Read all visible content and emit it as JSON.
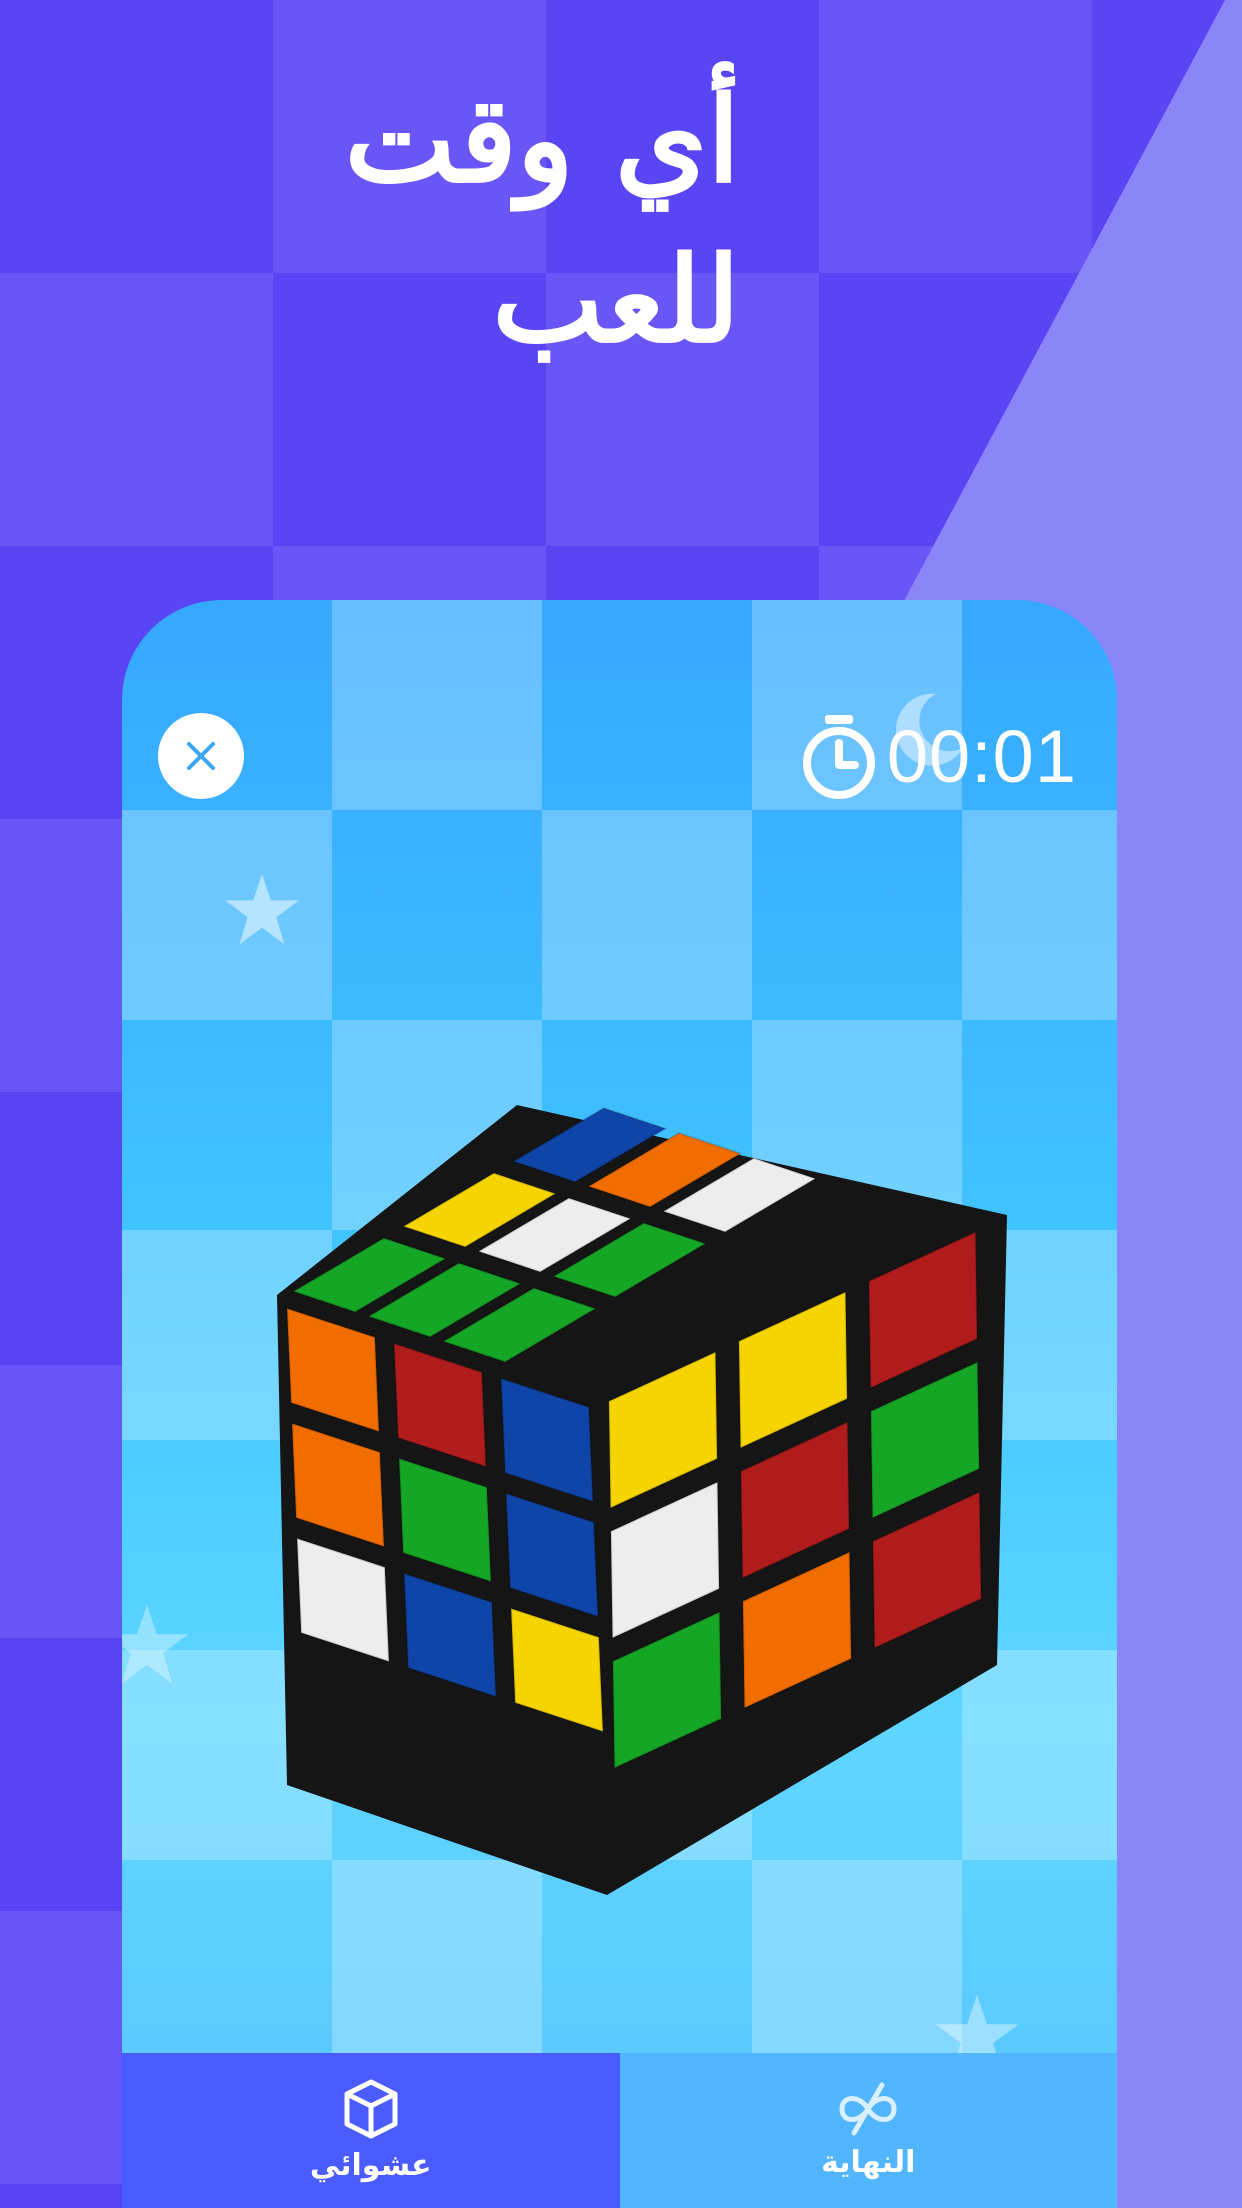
{
  "headline": "أي وقت للعب",
  "game": {
    "timer": "00:01",
    "close_icon": "close-icon",
    "stopwatch_icon": "stopwatch-icon"
  },
  "tabs": [
    {
      "label": "عشوائي",
      "icon": "cube-icon"
    },
    {
      "label": "النهاية",
      "icon": "infinity-off-icon"
    }
  ],
  "colors": {
    "background": "#5a45f5",
    "phone_top": "#36a8ff",
    "tab_random": "#4a5cff",
    "tab_end": "#52b6ff"
  },
  "cube": {
    "top": [
      [
        "green",
        "yellow",
        "blue"
      ],
      [
        "green",
        "white",
        "orange"
      ],
      [
        "green",
        "green",
        "white"
      ]
    ],
    "front": [
      [
        "orange",
        "red",
        "blue"
      ],
      [
        "orange",
        "green",
        "blue"
      ],
      [
        "white",
        "blue",
        "yellow"
      ]
    ],
    "right": [
      [
        "yellow",
        "yellow",
        "red"
      ],
      [
        "white",
        "red",
        "green"
      ],
      [
        "green",
        "orange",
        "red"
      ]
    ]
  }
}
